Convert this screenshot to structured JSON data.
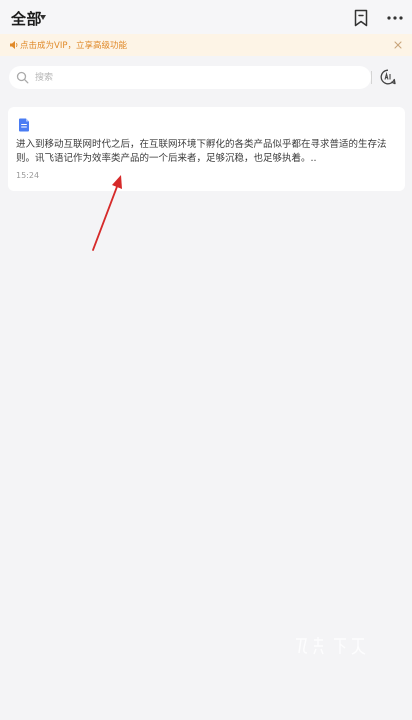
{
  "header": {
    "title": "全部",
    "icons": {
      "filter_caret": "caret-down-icon",
      "bookmark": "bookmark-icon",
      "more": "more-icon"
    }
  },
  "vip_banner": {
    "text": "点击成为VIP，立享高级功能",
    "icon": "speaker-icon",
    "close_icon": "close-icon"
  },
  "search": {
    "placeholder": "搜索",
    "value": "",
    "icon": "search-icon",
    "ai_icon": "ai-icon"
  },
  "notes": [
    {
      "text": "进入到移动互联网时代之后，在互联网环境下孵化的各类产品似乎都在寻求普适的生存法则。讯飞语记作为效率类产品的一个后来者，足够沉稳，也足够执着。..",
      "time": "15:24",
      "icon": "document-icon"
    }
  ],
  "colors": {
    "background": "#f4f4f6",
    "banner_bg": "#fdf4e6",
    "banner_text": "#e08a2a",
    "doc_icon": "#4a7cf3",
    "annotation": "#d62a2a"
  }
}
